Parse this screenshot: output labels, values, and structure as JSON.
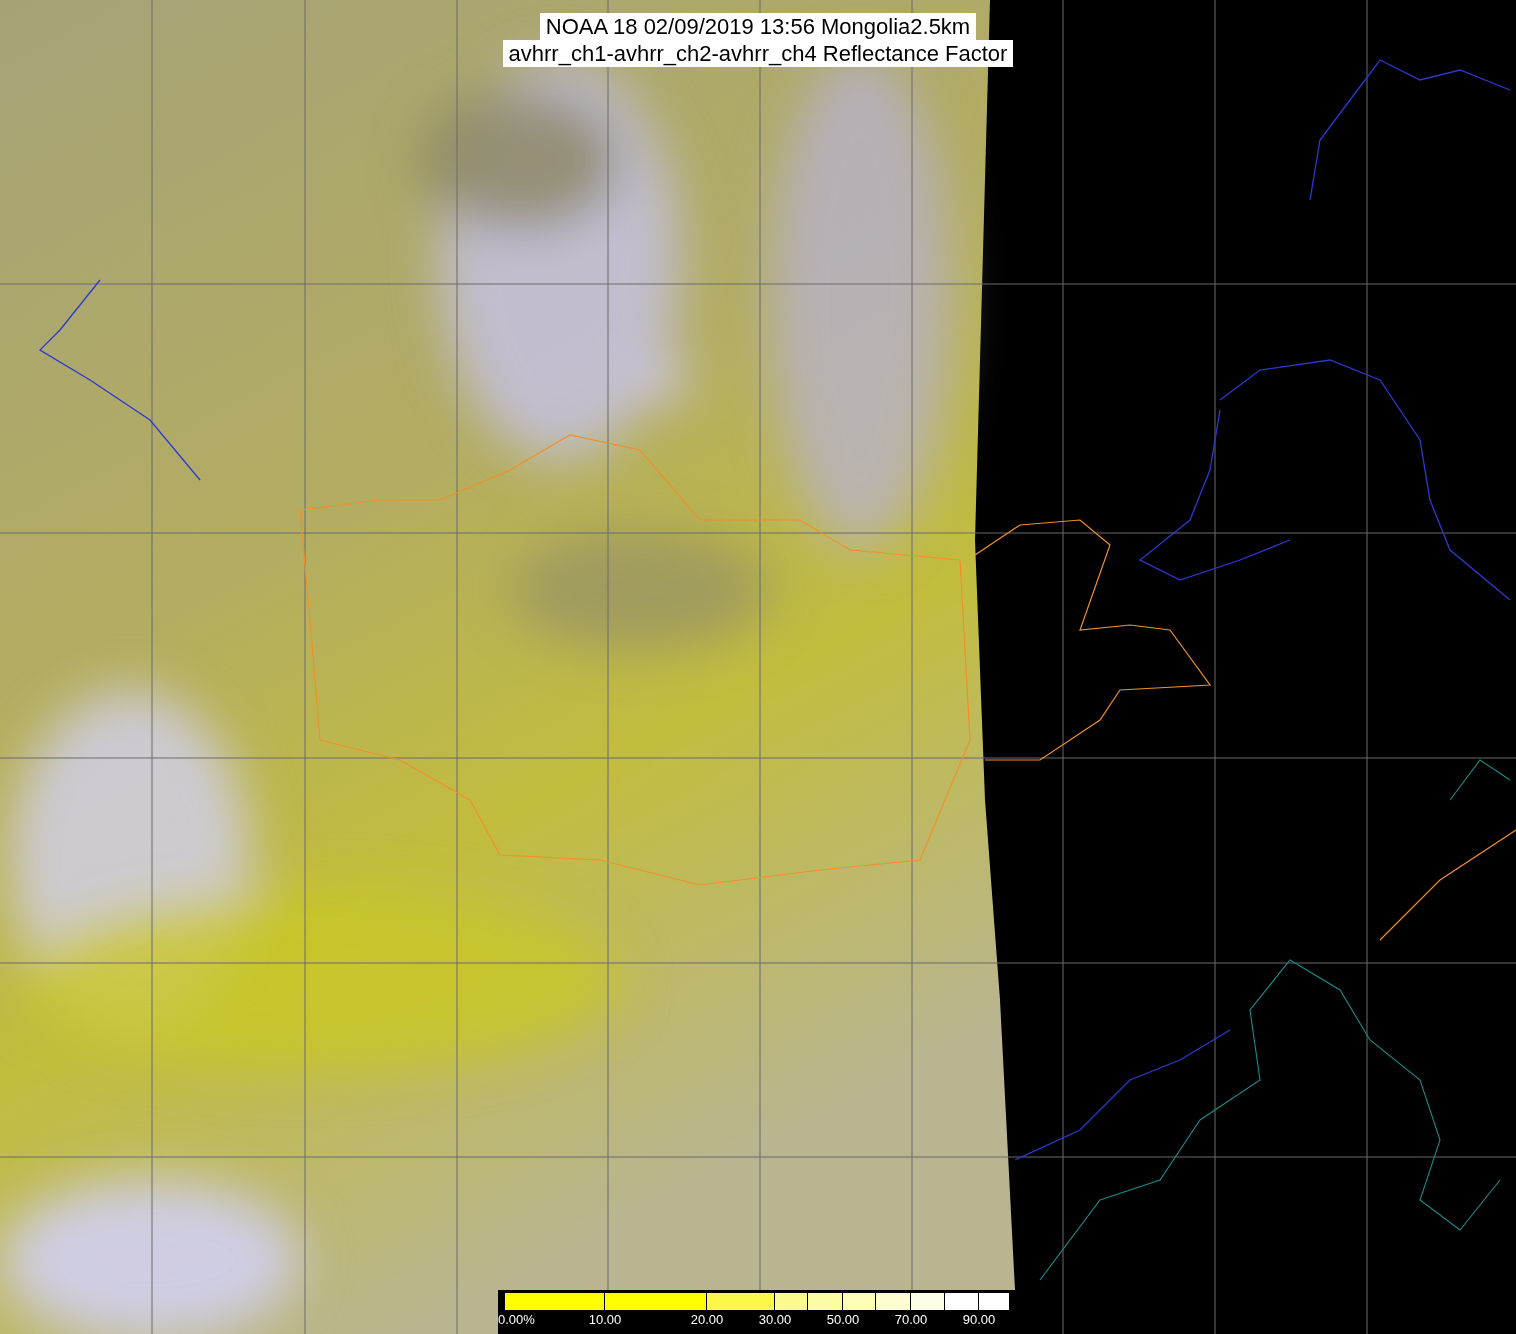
{
  "title_lines": [
    "NOAA 18 02/09/2019 13:56 Mongolia2.5km",
    "avhrr_ch1-avhrr_ch2-avhrr_ch4 Reflectance Factor"
  ],
  "colorbar": {
    "segments": [
      {
        "color": "#ffff00"
      },
      {
        "color": "#ffff00"
      },
      {
        "color": "#fbf84a"
      },
      {
        "color": "#fbfa8c"
      },
      {
        "color": "#fcfca2"
      },
      {
        "color": "#fdfdb8"
      },
      {
        "color": "#fdfdcf"
      },
      {
        "color": "#fefee6"
      },
      {
        "color": "#ffffff"
      },
      {
        "color": "#ffffff"
      }
    ],
    "labels": [
      "0.00%",
      "10.00",
      "20.00",
      "30.00",
      "50.00",
      "70.00",
      "90.00"
    ]
  }
}
